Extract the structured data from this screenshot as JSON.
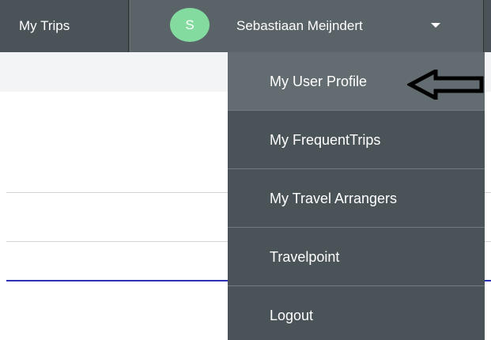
{
  "nav": {
    "my_trips_label": "My Trips",
    "user": {
      "avatar_initial": "S",
      "name": "Sebastiaan Meijndert",
      "dropdown_icon": "caret-down-icon"
    }
  },
  "dropdown": {
    "items": [
      {
        "label": "My User Profile",
        "active": true
      },
      {
        "label": "My FrequentTrips"
      },
      {
        "label": "My Travel Arrangers"
      },
      {
        "label": "Travelpoint"
      },
      {
        "label": "Logout"
      }
    ]
  },
  "annotation": {
    "icon": "left-arrow-icon"
  },
  "colors": {
    "topbar": "#4a5358",
    "user_tab": "#5a6367",
    "menu_bg": "#4a5358",
    "menu_active": "#636c70",
    "avatar": "#84dba0",
    "accent_line": "#2b35b4",
    "text": "#ffffff"
  }
}
